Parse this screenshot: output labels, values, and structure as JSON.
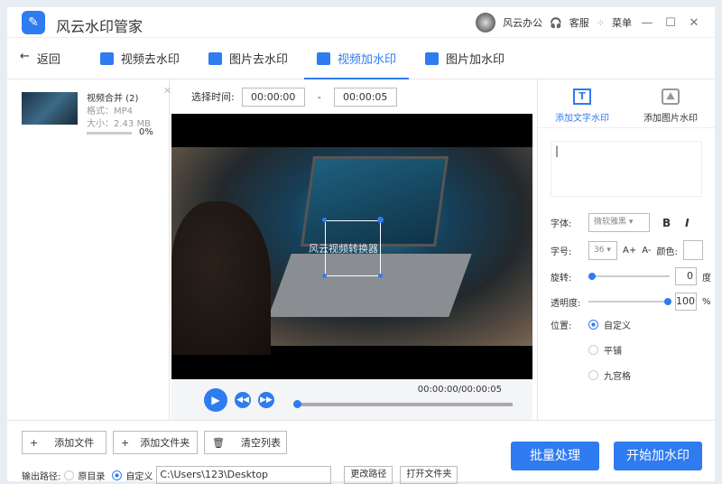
{
  "app": {
    "title": "风云水印管家",
    "user": "风云办公",
    "service": "客服",
    "menu": "菜单"
  },
  "nav": {
    "back": "返回",
    "tabs": [
      {
        "label": "视频去水印"
      },
      {
        "label": "图片去水印"
      },
      {
        "label": "视频加水印"
      },
      {
        "label": "图片加水印"
      }
    ]
  },
  "file": {
    "name": "视频合并 (2)",
    "format": "格式：MP4",
    "size": "大小：2.43 MB",
    "progress_percent": 0,
    "progress_label": "0%"
  },
  "time": {
    "label": "选择时间:",
    "start": "00:00:00",
    "separator": "-",
    "end": "00:00:05"
  },
  "player": {
    "time": "00:00:00/00:00:05",
    "watermark_text": "风云视频转换器"
  },
  "right": {
    "tabs": [
      {
        "label": "添加文字水印"
      },
      {
        "label": "添加图片水印"
      }
    ],
    "font_label": "字体:",
    "font_value": "微软雅黑",
    "bold": "B",
    "italic": "I",
    "size_label": "字号:",
    "size_value": "36",
    "inc": "A+",
    "dec": "A-",
    "color_label": "颜色:",
    "rotate_label": "旋转:",
    "rotate_value": "0",
    "rotate_unit": "度",
    "opacity_label": "透明度:",
    "opacity_value": "100",
    "opacity_unit": "%",
    "position_label": "位置:",
    "positions": [
      {
        "label": "自定义"
      },
      {
        "label": "平铺"
      },
      {
        "label": "九宫格"
      }
    ]
  },
  "bottom": {
    "add_file": "添加文件",
    "add_folder": "添加文件夹",
    "clear": "清空列表",
    "output_label": "输出路径:",
    "opt_original": "原目录",
    "opt_custom": "自定义",
    "path": "C:\\Users\\123\\Desktop",
    "change_path": "更改路径",
    "open_folder": "打开文件夹",
    "batch": "批量处理",
    "start": "开始加水印"
  }
}
